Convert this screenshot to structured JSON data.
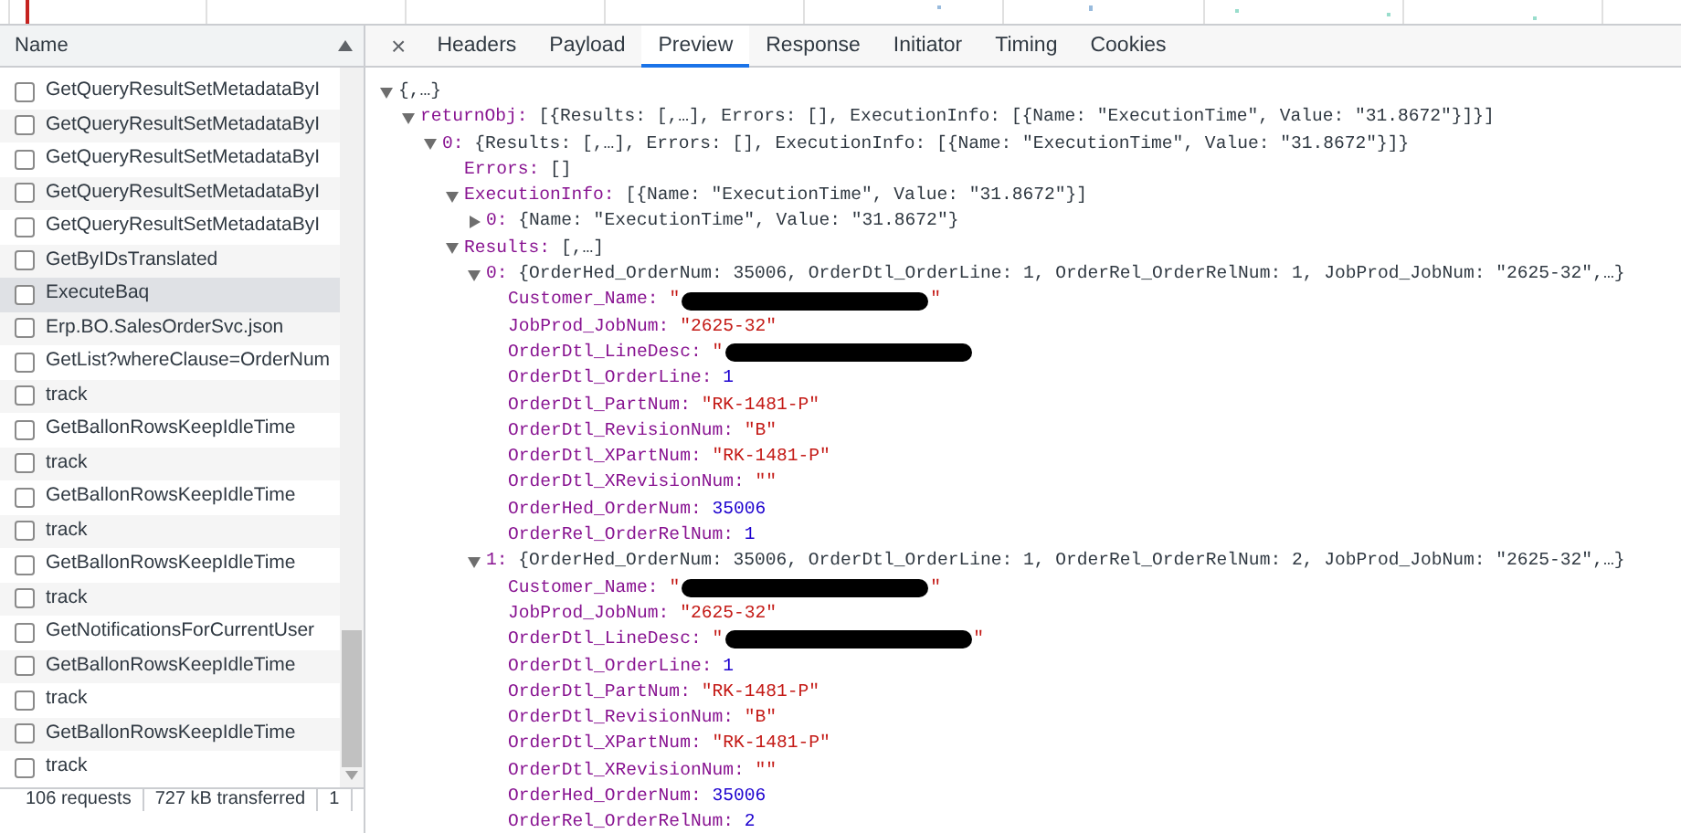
{
  "requests": {
    "header": "Name",
    "rows": [
      {
        "label": "GetQueryResultSetMetadataByI",
        "selected": false,
        "checked": false
      },
      {
        "label": "GetQueryResultSetMetadataByI",
        "selected": false,
        "checked": false
      },
      {
        "label": "GetQueryResultSetMetadataByI",
        "selected": false,
        "checked": false
      },
      {
        "label": "GetQueryResultSetMetadataByI",
        "selected": false,
        "checked": false
      },
      {
        "label": "GetQueryResultSetMetadataByI",
        "selected": false,
        "checked": false
      },
      {
        "label": "GetByIDsTranslated",
        "selected": false,
        "checked": false
      },
      {
        "label": "ExecuteBaq",
        "selected": true,
        "checked": false
      },
      {
        "label": "Erp.BO.SalesOrderSvc.json",
        "selected": false,
        "checked": false
      },
      {
        "label": "GetList?whereClause=OrderNum",
        "selected": false,
        "checked": false
      },
      {
        "label": "track",
        "selected": false,
        "checked": false
      },
      {
        "label": "GetBallonRowsKeepIdleTime",
        "selected": false,
        "checked": false
      },
      {
        "label": "track",
        "selected": false,
        "checked": false
      },
      {
        "label": "GetBallonRowsKeepIdleTime",
        "selected": false,
        "checked": false
      },
      {
        "label": "track",
        "selected": false,
        "checked": false
      },
      {
        "label": "GetBallonRowsKeepIdleTime",
        "selected": false,
        "checked": false
      },
      {
        "label": "track",
        "selected": false,
        "checked": false
      },
      {
        "label": "GetNotificationsForCurrentUser",
        "selected": false,
        "checked": false
      },
      {
        "label": "GetBallonRowsKeepIdleTime",
        "selected": false,
        "checked": false
      },
      {
        "label": "track",
        "selected": false,
        "checked": false
      },
      {
        "label": "GetBallonRowsKeepIdleTime",
        "selected": false,
        "checked": false
      },
      {
        "label": "track",
        "selected": false,
        "checked": false
      }
    ]
  },
  "status_bar": [
    "106 requests",
    "727 kB transferred",
    "1"
  ],
  "close_tab": "×",
  "tabs": [
    {
      "label": "Headers",
      "selected": false
    },
    {
      "label": "Payload",
      "selected": false
    },
    {
      "label": "Preview",
      "selected": true
    },
    {
      "label": "Response",
      "selected": false
    },
    {
      "label": "Initiator",
      "selected": false
    },
    {
      "label": "Timing",
      "selected": false
    },
    {
      "label": "Cookies",
      "selected": false
    }
  ],
  "preview": {
    "kind": "node",
    "summary": "{,…}",
    "expanded": true,
    "children": [
      {
        "kind": "node",
        "key": "returnObj:",
        "summary": "[{Results: [,…], Errors: [], ExecutionInfo: [{Name: \"ExecutionTime\", Value: \"31.8672\"}]}]",
        "expanded": true,
        "children": [
          {
            "kind": "node",
            "key": "0:",
            "summary": "{Results: [,…], Errors: [], ExecutionInfo: [{Name: \"ExecutionTime\", Value: \"31.8672\"}]}",
            "expanded": true,
            "children": [
              {
                "kind": "plain",
                "key": "Errors:",
                "value": "[]"
              },
              {
                "kind": "node",
                "key": "ExecutionInfo:",
                "summary": "[{Name: \"ExecutionTime\", Value: \"31.8672\"}]",
                "expanded": true,
                "children": [
                  {
                    "kind": "node",
                    "key": "0:",
                    "summary": "{Name: \"ExecutionTime\", Value: \"31.8672\"}",
                    "expanded": false
                  }
                ]
              },
              {
                "kind": "node",
                "key": "Results:",
                "summary": "[,…]",
                "expanded": true,
                "children": [
                  {
                    "kind": "node",
                    "key": "0:",
                    "summary": "{OrderHed_OrderNum: 35006, OrderDtl_OrderLine: 1, OrderRel_OrderRelNum: 1, JobProd_JobNum: \"2625-32\",…}",
                    "expanded": true,
                    "children": [
                      {
                        "kind": "redacted",
                        "key": "Customer_Name:",
                        "value": "\"",
                        "close": "\""
                      },
                      {
                        "kind": "string",
                        "key": "JobProd_JobNum:",
                        "value": "\"2625-32\""
                      },
                      {
                        "kind": "redacted",
                        "key": "OrderDtl_LineDesc:",
                        "value": "\""
                      },
                      {
                        "kind": "number",
                        "key": "OrderDtl_OrderLine:",
                        "value": "1"
                      },
                      {
                        "kind": "string",
                        "key": "OrderDtl_PartNum:",
                        "value": "\"RK-1481-P\""
                      },
                      {
                        "kind": "string",
                        "key": "OrderDtl_RevisionNum:",
                        "value": "\"B\""
                      },
                      {
                        "kind": "string",
                        "key": "OrderDtl_XPartNum:",
                        "value": "\"RK-1481-P\""
                      },
                      {
                        "kind": "string",
                        "key": "OrderDtl_XRevisionNum:",
                        "value": "\"\""
                      },
                      {
                        "kind": "number",
                        "key": "OrderHed_OrderNum:",
                        "value": "35006"
                      },
                      {
                        "kind": "number",
                        "key": "OrderRel_OrderRelNum:",
                        "value": "1"
                      }
                    ]
                  },
                  {
                    "kind": "node",
                    "key": "1:",
                    "summary": "{OrderHed_OrderNum: 35006, OrderDtl_OrderLine: 1, OrderRel_OrderRelNum: 2, JobProd_JobNum: \"2625-32\",…}",
                    "expanded": true,
                    "children": [
                      {
                        "kind": "redacted",
                        "key": "Customer_Name:",
                        "value": "\"",
                        "close": "\""
                      },
                      {
                        "kind": "string",
                        "key": "JobProd_JobNum:",
                        "value": "\"2625-32\""
                      },
                      {
                        "kind": "redacted",
                        "key": "OrderDtl_LineDesc:",
                        "value": "\"",
                        "close": "\""
                      },
                      {
                        "kind": "number",
                        "key": "OrderDtl_OrderLine:",
                        "value": "1"
                      },
                      {
                        "kind": "string",
                        "key": "OrderDtl_PartNum:",
                        "value": "\"RK-1481-P\""
                      },
                      {
                        "kind": "string",
                        "key": "OrderDtl_RevisionNum:",
                        "value": "\"B\""
                      },
                      {
                        "kind": "string",
                        "key": "OrderDtl_XPartNum:",
                        "value": "\"RK-1481-P\""
                      },
                      {
                        "kind": "string",
                        "key": "OrderDtl_XRevisionNum:",
                        "value": "\"\""
                      },
                      {
                        "kind": "number",
                        "key": "OrderHed_OrderNum:",
                        "value": "35006"
                      },
                      {
                        "kind": "number",
                        "key": "OrderRel_OrderRelNum:",
                        "value": "2"
                      }
                    ]
                  }
                ]
              }
            ]
          }
        ]
      }
    ]
  }
}
